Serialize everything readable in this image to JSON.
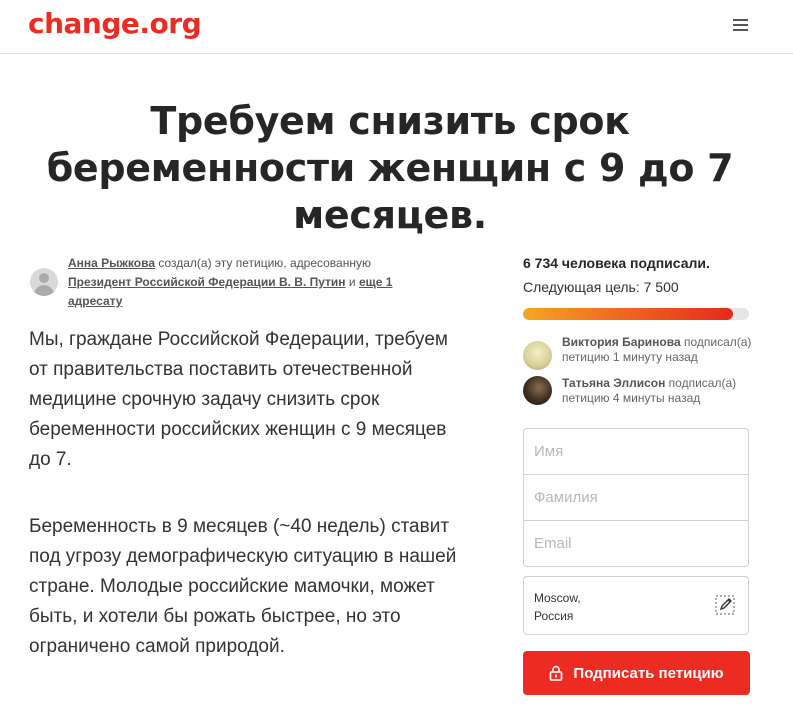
{
  "header": {
    "logo_text": "change.org",
    "menu_icon": "hamburger-menu-icon"
  },
  "petition": {
    "title": "Требуем снизить срок беременности женщин с 9 до 7 месяцев.",
    "author": {
      "name": "Анна Рыжкова",
      "created_text": " создал(а) эту петицию, адресованную ",
      "recipient": "Президент Российской Федерации В. В. Путин",
      "and_text": " и ",
      "more_link": "еще 1 адресату"
    },
    "paragraphs": [
      "Мы, граждане Российской Федерации, требуем от правительства поставить отечественной медицине срочную задачу снизить срок беременности российских женщин с 9 месяцев до 7.",
      "Беременность в 9 месяцев (~40 недель) ставит под угрозу демографическую ситуацию в нашей стране. Молодые российские мамочки, может быть, и хотели бы рожать быстрее, но это ограничено самой природой."
    ]
  },
  "signatures": {
    "count_text": "6 734 человека подписали.",
    "goal_text": "Следующая цель: 7 500",
    "count": 6734,
    "goal": 7500,
    "progress_fraction": 0.93
  },
  "recent_signers": [
    {
      "name": "Виктория Баринова",
      "action": " подписал(а) петицию 1 минуту назад"
    },
    {
      "name": "Татьяна Эллисон",
      "action": " подписал(а) петицию 4 минуты назад"
    }
  ],
  "form": {
    "first_name_placeholder": "Имя",
    "last_name_placeholder": "Фамилия",
    "email_placeholder": "Email",
    "location_line1": "Moscow,",
    "location_line2": "Россия",
    "submit_label": "Подписать петицию"
  },
  "colors": {
    "brand_red": "#ec2c22",
    "progress_start": "#f5a623",
    "progress_end": "#e42a1d"
  }
}
